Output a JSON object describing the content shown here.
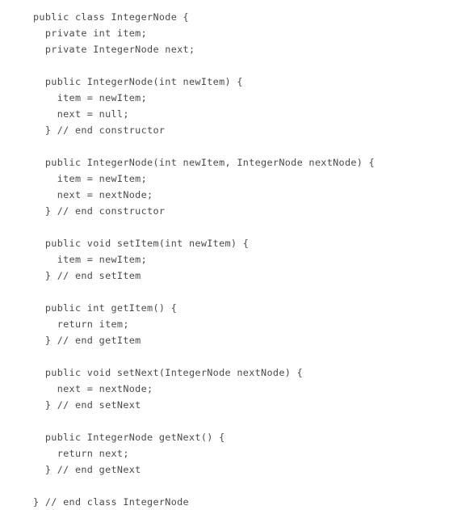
{
  "document": {
    "kind": "java-source-listing",
    "class_name": "IntegerNode",
    "language": "Java",
    "background_color": "#ffffff",
    "text_color": "#4a4a4a",
    "indent_unit_spaces": 2,
    "line_count": 31
  },
  "code": {
    "lines": [
      "public class IntegerNode {",
      "  private int item;",
      "  private IntegerNode next;",
      "",
      "  public IntegerNode(int newItem) {",
      "    item = newItem;",
      "    next = null;",
      "  } // end constructor",
      "",
      "  public IntegerNode(int newItem, IntegerNode nextNode) {",
      "    item = newItem;",
      "    next = nextNode;",
      "  } // end constructor",
      "",
      "  public void setItem(int newItem) {",
      "    item = newItem;",
      "  } // end setItem",
      "",
      "  public int getItem() {",
      "    return item;",
      "  } // end getItem",
      "",
      "  public void setNext(IntegerNode nextNode) {",
      "    next = nextNode;",
      "  } // end setNext",
      "",
      "  public IntegerNode getNext() {",
      "    return next;",
      "  } // end getNext",
      "",
      "} // end class IntegerNode"
    ]
  }
}
